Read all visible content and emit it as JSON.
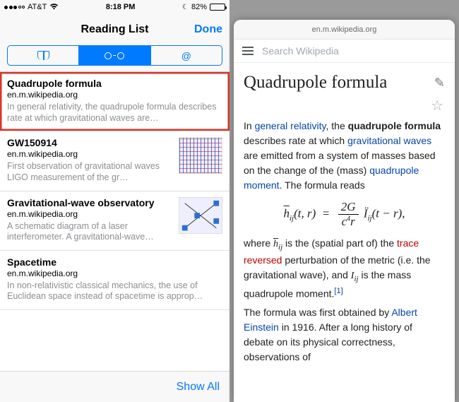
{
  "status": {
    "carrier": "AT&T",
    "time": "8:18 PM",
    "battery_pct": "82%"
  },
  "nav": {
    "title": "Reading List",
    "done": "Done"
  },
  "seg": {
    "bookmarks_icon": "book-icon",
    "readinglist_icon": "glasses-icon",
    "shared_label": "@"
  },
  "items": [
    {
      "title": "Quadrupole formula",
      "source": "en.m.wikipedia.org",
      "desc": "In general relativity, the quadrupole formula describes rate at which gravitational waves are…",
      "has_thumb": false,
      "highlighted": true
    },
    {
      "title": "GW150914",
      "source": "en.m.wikipedia.org",
      "desc": "First observation of gravitational waves LIGO measurement of the gr…",
      "has_thumb": true,
      "thumb_kind": "g1"
    },
    {
      "title": "Gravitational-wave observatory",
      "source": "en.m.wikipedia.org",
      "desc": "A schematic diagram of a laser interferometer. A gravitational-wave…",
      "has_thumb": true,
      "thumb_kind": "g2"
    },
    {
      "title": "Spacetime",
      "source": "en.m.wikipedia.org",
      "desc": "In non-relativistic classical mechanics, the use of Euclidean space instead of spacetime is approp…",
      "has_thumb": false
    }
  ],
  "footer": {
    "show_all": "Show All"
  },
  "right": {
    "url": "en.m.wikipedia.org",
    "search_placeholder": "Search Wikipedia",
    "article_title": "Quadrupole formula",
    "p1_pre": "In ",
    "p1_link1": "general relativity",
    "p1_mid1": ", the ",
    "p1_bold": "quadrupole formula",
    "p1_mid2": " describes rate at which ",
    "p1_link2": "gravitational waves",
    "p1_mid3": " are emitted from a system of masses based on the change of the (mass) ",
    "p1_link3": "quadrupole moment",
    "p1_end": ". The formula reads",
    "tv": "(t, r)",
    "numG": "2G",
    "denC": "c",
    "denExp": "4",
    "denR": "r",
    "tmr": "(t − r),",
    "p2_a": "where ",
    "p2_b": " is the (spatial part of) the ",
    "p2_red": "trace reversed",
    "p2_c": " perturbation of the metric (i.e. the gravitational wave), and ",
    "p2_d": " is the mass quadrupole moment.",
    "ref1": "[1]",
    "p3_a": "The formula was first obtained by ",
    "p3_link": "Albert Einstein",
    "p3_b": " in 1916. After a long history of debate on its physical correctness, observations of"
  }
}
